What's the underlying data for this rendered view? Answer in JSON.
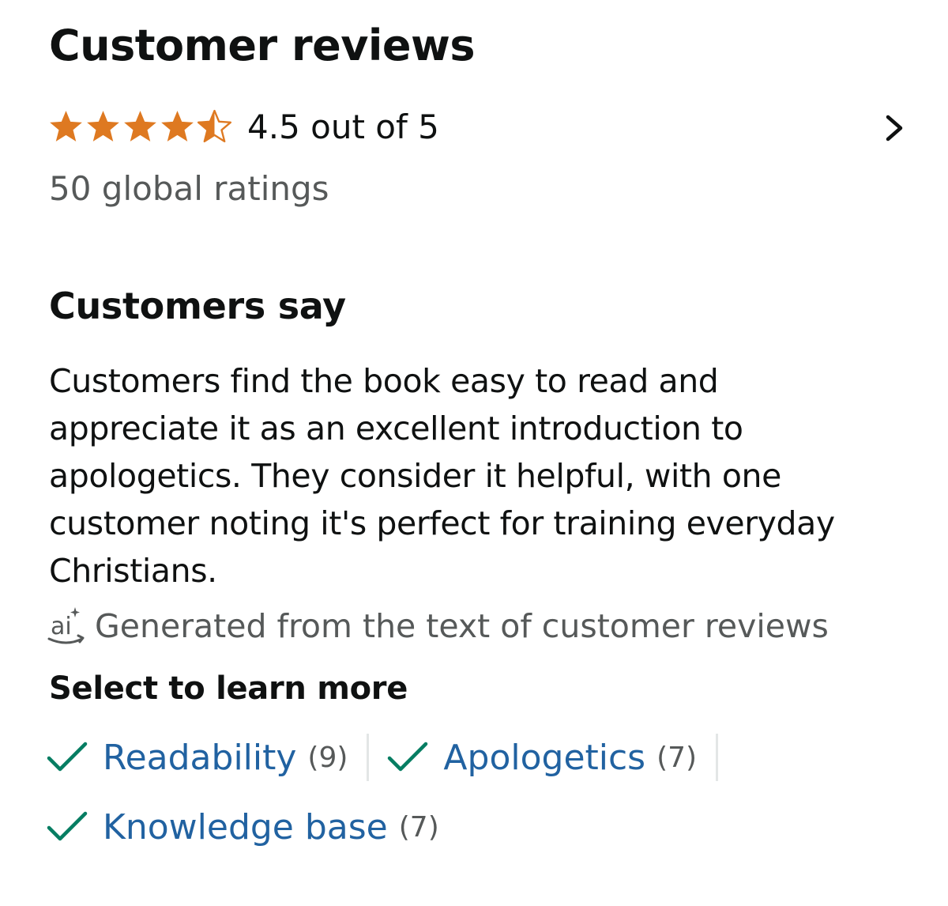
{
  "header": {
    "title": "Customer reviews"
  },
  "rating": {
    "value": 4.5,
    "max": 5,
    "text": "4.5 out of 5",
    "global_ratings": "50 global ratings",
    "star_color": "#de7921"
  },
  "customers_say": {
    "title": "Customers say",
    "summary": "Customers find the book easy to read and appreciate it as an excellent introduction to apologetics. They consider it helpful, with one customer noting it's perfect for training everyday Christians.",
    "disclaimer": "Generated from the text of customer reviews",
    "disclaimer_icon": "ai-icon"
  },
  "learn_more": {
    "title": "Select to learn more",
    "aspects": [
      {
        "label": "Readability",
        "count": "(9)"
      },
      {
        "label": "Apologetics",
        "count": "(7)"
      },
      {
        "label": "Knowledge base",
        "count": "(7)"
      }
    ]
  },
  "colors": {
    "link": "#2162a1",
    "check": "#067d62",
    "secondary_text": "#565959"
  },
  "icons": {
    "chevron": "chevron-right-icon",
    "check": "checkmark-icon"
  }
}
